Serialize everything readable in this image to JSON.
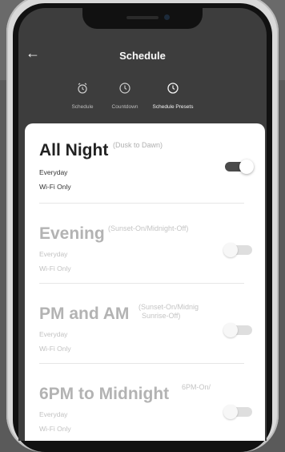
{
  "header": {
    "title": "Schedule"
  },
  "tabs": [
    {
      "label": "Schedule",
      "icon": "alarm-clock-icon",
      "active": false
    },
    {
      "label": "Countdown",
      "icon": "clock-icon",
      "active": false
    },
    {
      "label": "Schedule Presets",
      "icon": "clock-icon",
      "active": true
    }
  ],
  "presets": [
    {
      "name": "All Night",
      "desc": "(Dusk to Dawn)",
      "sub1": "Everyday",
      "sub2": "Wi-Fi Only",
      "enabled": true
    },
    {
      "name": "Evening",
      "desc": "(Sunset-On/Midnight-Off)",
      "sub1": "Everyday",
      "sub2": "Wi-Fi Only",
      "enabled": false
    },
    {
      "name": "PM and AM",
      "desc1": "(Sunset-On/Midnig",
      "desc2": "Sunrise-Off)",
      "sub1": "Everyday",
      "sub2": "Wi-Fi Only",
      "enabled": false
    },
    {
      "name": "6PM to Midnight",
      "desc": "6PM-On/",
      "sub1": "Everyday",
      "sub2": "Wi-Fi Only",
      "enabled": false
    }
  ],
  "colors": {
    "app_bar": "#3d3d3d",
    "toggle_on": "#4a4a4a",
    "toggle_off": "#dedede"
  }
}
